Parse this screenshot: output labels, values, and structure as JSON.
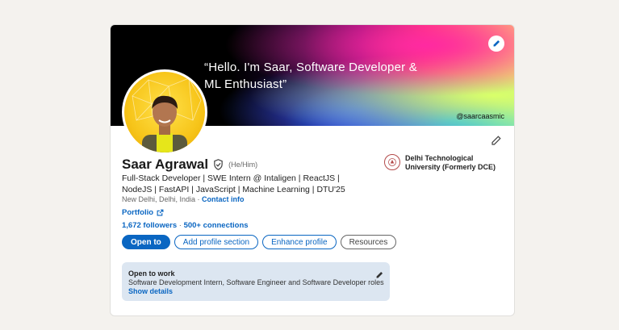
{
  "banner": {
    "quote": "“Hello. I'm Saar, Software Developer & ML Enthusiast”",
    "handle": "@saarcaasmic",
    "edit_icon": "pencil-icon"
  },
  "profile": {
    "name": "Saar Agrawal",
    "verified_icon": "shield-check-icon",
    "pronouns": "(He/Him)",
    "headline": "Full-Stack Developer | SWE Intern @ Intaligen | ReactJS | NodeJS | FastAPI | JavaScript | Machine Learning | DTU'25",
    "location": "New Delhi, Delhi, India",
    "location_separator": " · ",
    "contact_info": "Contact info",
    "portfolio_label": "Portfolio",
    "followers": "1,672 followers",
    "stats_separator": " · ",
    "connections": "500+ connections"
  },
  "education": {
    "school": "Delhi Technological University (Formerly DCE)"
  },
  "actions": {
    "open_to": "Open to",
    "add_section": "Add profile section",
    "enhance": "Enhance profile",
    "resources": "Resources"
  },
  "open_to_work": {
    "title": "Open to work",
    "roles": "Software Development Intern, Software Engineer and Software Developer roles",
    "show_details": "Show details"
  },
  "colors": {
    "accent": "#0a66c2",
    "otw_background": "#dce6f1"
  }
}
